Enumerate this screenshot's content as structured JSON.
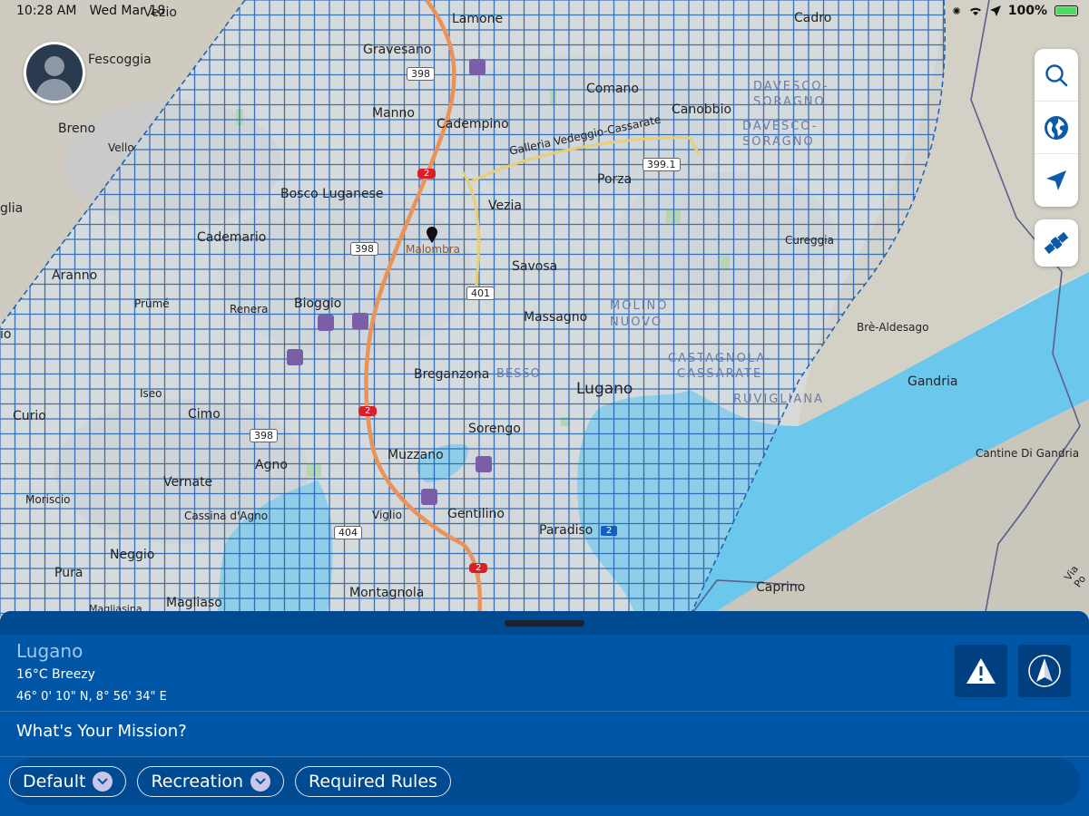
{
  "status_bar": {
    "time": "10:28 AM",
    "date": "Wed Mar 18",
    "battery_percent": "100%",
    "battery_level": 1.0,
    "icons": [
      "signal-icon",
      "wifi-icon",
      "location-arrow-icon",
      "battery-icon"
    ]
  },
  "map": {
    "places": {
      "vezio": "Vezio",
      "lamone": "Lamone",
      "cadro": "Cadro",
      "fescoggia": "Fescoggia",
      "gravesano": "Gravesano",
      "comano": "Comano",
      "davesco1": "DAVESCO-",
      "soragno1": "SORAGNO",
      "davesco2": "DAVESCO-",
      "soragno2": "SORAGNO",
      "breno": "Breno",
      "manno": "Manno",
      "cadempino": "Cadempino",
      "canobbio": "Canobbio",
      "vello": "Vello",
      "galleria": "Galleria Vedeggio-Cassarate",
      "porza": "Porza",
      "bosco": "Bosco Luganese",
      "vezia": "Vezia",
      "glia": "glia",
      "cademario": "Cademario",
      "malombra": "Malombra",
      "cureggia": "Cureggia",
      "savosa": "Savosa",
      "aranno": "Aranno",
      "prume": "Prümé",
      "renera": "Renera",
      "bioggio": "Bioggio",
      "molino": "MOLINO",
      "nuovo": "NUOVO",
      "massagno": "Massagno",
      "brealdesago": "Brè-Aldesago",
      "io": "io",
      "castagnola": "CASTAGNOLA-",
      "cassarate": "CASSARATE",
      "breganzona": "Breganzona",
      "besso": "BESSO",
      "lugano": "Lugano",
      "gandria": "Gandria",
      "iseo": "Iseo",
      "ruvigliana": "RUVIGLIANA",
      "curio": "Curio",
      "cimo": "Cimo",
      "sorengo": "Sorengo",
      "cantine": "Cantine Di Gandria",
      "muzzano": "Muzzano",
      "agno": "Agno",
      "vernate": "Vernate",
      "morisciο": "Morisciο",
      "cassina": "Cassina d'Agno",
      "viglio": "Viglio",
      "gentilino": "Gentilino",
      "paradiso": "Paradiso",
      "neggio": "Neggio",
      "pura": "Pura",
      "caprino": "Caprino",
      "montagnola": "Montagnola",
      "magliaso": "Magliaso",
      "magliasina": "Magliasina",
      "viapo": "Via Po"
    },
    "road_shields": {
      "r398a": "398",
      "r2a": "2",
      "r399": "399.1",
      "r398b": "398",
      "r401": "401",
      "r2b": "2",
      "r398c": "398",
      "r404": "404",
      "r2c": "2",
      "r2blue": "2"
    }
  },
  "tools": {
    "search": "search-icon",
    "globe": "globe-icon",
    "locate": "location-arrow-icon",
    "satellite": "satellite-icon"
  },
  "panel": {
    "location_name": "Lugano",
    "weather": "16°C Breezy",
    "coordinates": "46° 0' 10\" N, 8° 56' 34\" E",
    "mission_prompt": "What's Your Mission?",
    "chips": {
      "default": "Default",
      "recreation": "Recreation",
      "required_rules": "Required Rules"
    }
  },
  "colors": {
    "panel_blue": "#0056a6",
    "grid_blue": "#1d5fae",
    "water": "#6cc7ec",
    "motorway": "#e9925a"
  }
}
